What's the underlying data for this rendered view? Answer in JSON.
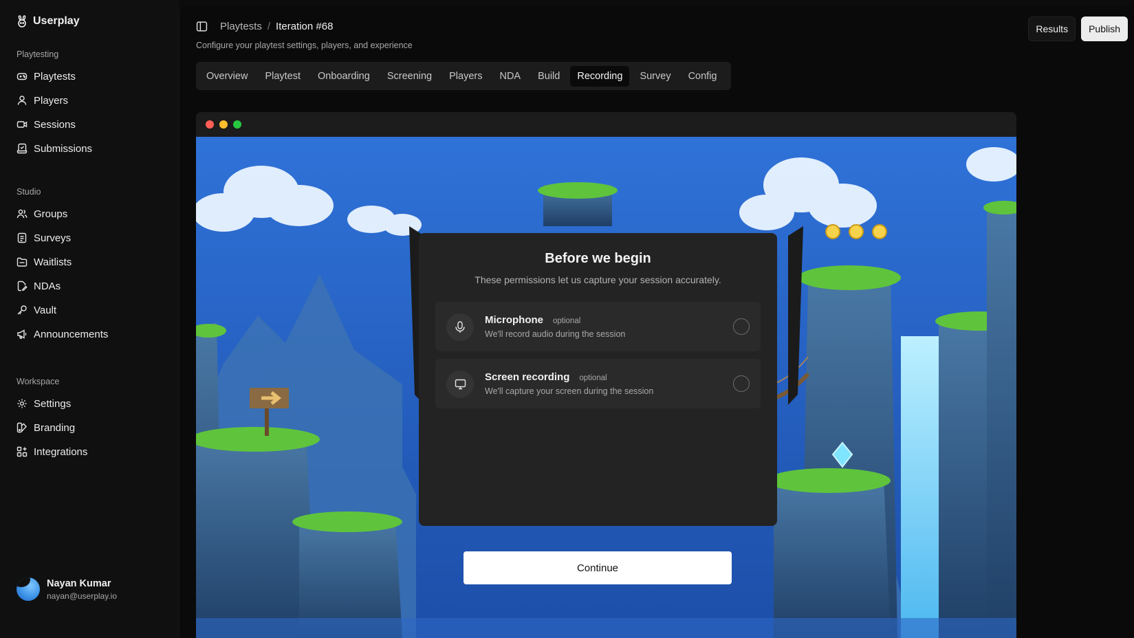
{
  "brand": {
    "name": "Userplay",
    "logo_icon": "rabbit-logo-icon"
  },
  "sidebar": {
    "sections": [
      {
        "label": "Playtesting",
        "items": [
          {
            "label": "Playtests",
            "icon": "gamepad-icon"
          },
          {
            "label": "Players",
            "icon": "user-icon"
          },
          {
            "label": "Sessions",
            "icon": "video-icon"
          },
          {
            "label": "Submissions",
            "icon": "submissions-icon"
          }
        ]
      },
      {
        "label": "Studio",
        "items": [
          {
            "label": "Groups",
            "icon": "users-icon"
          },
          {
            "label": "Surveys",
            "icon": "survey-icon"
          },
          {
            "label": "Waitlists",
            "icon": "folder-icon"
          },
          {
            "label": "NDAs",
            "icon": "file-edit-icon"
          },
          {
            "label": "Vault",
            "icon": "key-icon"
          },
          {
            "label": "Announcements",
            "icon": "megaphone-icon"
          }
        ]
      },
      {
        "label": "Workspace",
        "items": [
          {
            "label": "Settings",
            "icon": "gear-icon"
          },
          {
            "label": "Branding",
            "icon": "branding-icon"
          },
          {
            "label": "Integrations",
            "icon": "grid-plus-icon"
          }
        ]
      }
    ]
  },
  "user": {
    "name": "Nayan Kumar",
    "email": "nayan@userplay.io"
  },
  "header": {
    "breadcrumb": [
      "Playtests",
      "Iteration #68"
    ],
    "subtitle": "Configure your playtest settings, players, and experience",
    "results_label": "Results",
    "publish_label": "Publish"
  },
  "tabs": [
    "Overview",
    "Playtest",
    "Onboarding",
    "Screening",
    "Players",
    "NDA",
    "Build",
    "Recording",
    "Survey",
    "Config"
  ],
  "active_tab": "Recording",
  "preview": {
    "traffic_lights": [
      "#ff5f57",
      "#febc2e",
      "#28c840"
    ],
    "modal": {
      "title": "Before we begin",
      "subtitle": "These permissions let us capture your session accurately.",
      "permissions": [
        {
          "title": "Microphone",
          "tag": "optional",
          "desc": "We'll record audio during the session",
          "icon": "microphone-icon"
        },
        {
          "title": "Screen recording",
          "tag": "optional",
          "desc": "We'll capture your screen during the session",
          "icon": "monitor-icon"
        }
      ]
    },
    "continue_label": "Continue"
  },
  "colors": {
    "sky_top": "#2f6fd6",
    "sky_bottom": "#1e4fae",
    "grass": "#5fc43c",
    "rock": "#355f86"
  }
}
